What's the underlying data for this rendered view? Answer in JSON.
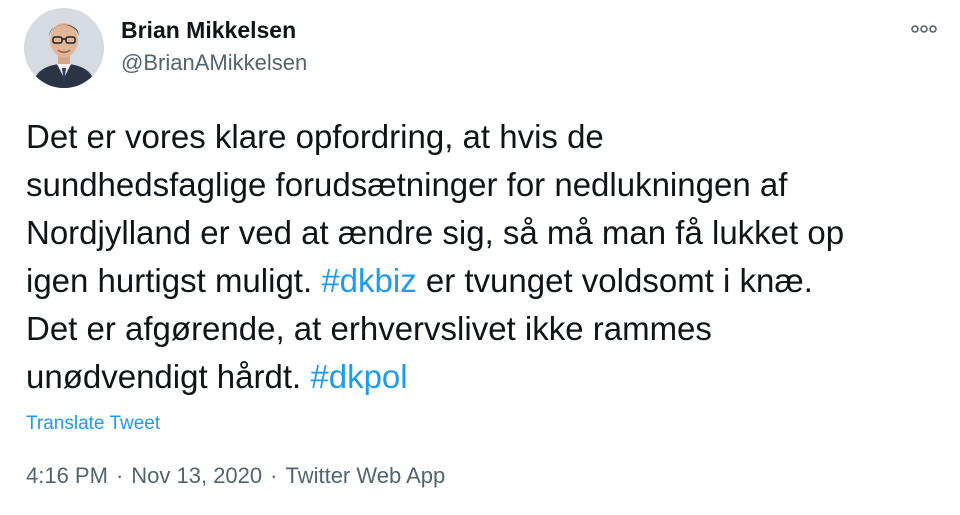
{
  "author": {
    "display_name": "Brian Mikkelsen",
    "handle": "@BrianAMikkelsen",
    "avatar_icon": "profile-photo"
  },
  "more_icon": "more-options-icon",
  "tweet": {
    "lines": [
      [
        {
          "text": "Det er vores klare opfordring, at hvis de"
        }
      ],
      [
        {
          "text": "sundhedsfaglige forudsætninger for nedlukningen af"
        }
      ],
      [
        {
          "text": "Nordjylland er ved at ændre sig, så må man få lukket op"
        }
      ],
      [
        {
          "text": "igen hurtigst muligt. "
        },
        {
          "text": "#dkbiz",
          "hashtag": true
        },
        {
          "text": " er tvunget voldsomt i knæ."
        }
      ],
      [
        {
          "text": "Det er afgørende, at erhvervslivet ikke rammes"
        }
      ],
      [
        {
          "text": "unødvendigt hårdt. "
        },
        {
          "text": "#dkpol",
          "hashtag": true
        }
      ]
    ]
  },
  "translate_label": "Translate Tweet",
  "meta": {
    "time": "4:16 PM",
    "separator": "·",
    "date": "Nov 13, 2020",
    "source": "Twitter Web App"
  },
  "colors": {
    "text": "#0f1419",
    "secondary": "#536471",
    "link": "#1d9bf0"
  }
}
